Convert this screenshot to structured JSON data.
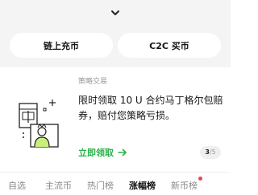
{
  "header": {
    "collapse_icon": "chevron-down-icon"
  },
  "quick_actions": {
    "onchain_deposit": "链上充币",
    "c2c_buy": "C2C 买币"
  },
  "promo": {
    "tag": "策略交易",
    "text": "限时领取 10 U 合约马丁格尔包赔券，赔付您策略亏损。",
    "cta": "立即领取",
    "cta_icon": "arrow-right-icon",
    "illustration": "coupon-with-character-illustration",
    "page_current": "3",
    "page_total": "/5"
  },
  "tabs": [
    "自选",
    "主流币",
    "热门榜",
    "涨幅榜",
    "新币榜"
  ],
  "active_tab": "涨幅榜",
  "colors": {
    "accent": "#2cb24a",
    "notification_dot": "#e5484d",
    "top_bg": "#f4f4f4"
  }
}
